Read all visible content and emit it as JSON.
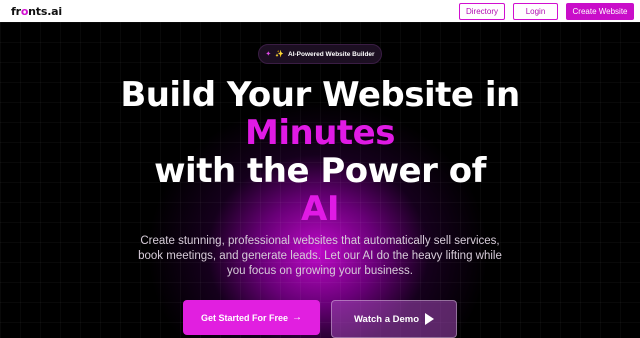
{
  "nav": {
    "logo_prefix": "fr",
    "logo_o": "o",
    "logo_suffix": "nts.ai",
    "directory_label": "Directory",
    "login_label": "Login",
    "create_label": "Create Website"
  },
  "hero": {
    "badge_text": "AI-Powered Website Builder",
    "headline": {
      "line1": "Build Your Website in",
      "line2": "Minutes",
      "line3": "with the Power of",
      "line4": "AI"
    },
    "subtitle": "Create stunning, professional websites that automatically sell services, book meetings, and generate leads. Let our AI do the heavy lifting while you focus on growing your business.",
    "primary_cta": "Get Started For Free",
    "primary_cta_arrow": "→",
    "secondary_cta": "Watch a Demo"
  },
  "colors": {
    "brand": "#d10fd0",
    "accent_text": "#e01ae5",
    "background": "#000000"
  },
  "icons": {
    "badge_icons": [
      "sparkle-icon",
      "star-icon"
    ],
    "secondary_cta_icon": "play-icon"
  }
}
